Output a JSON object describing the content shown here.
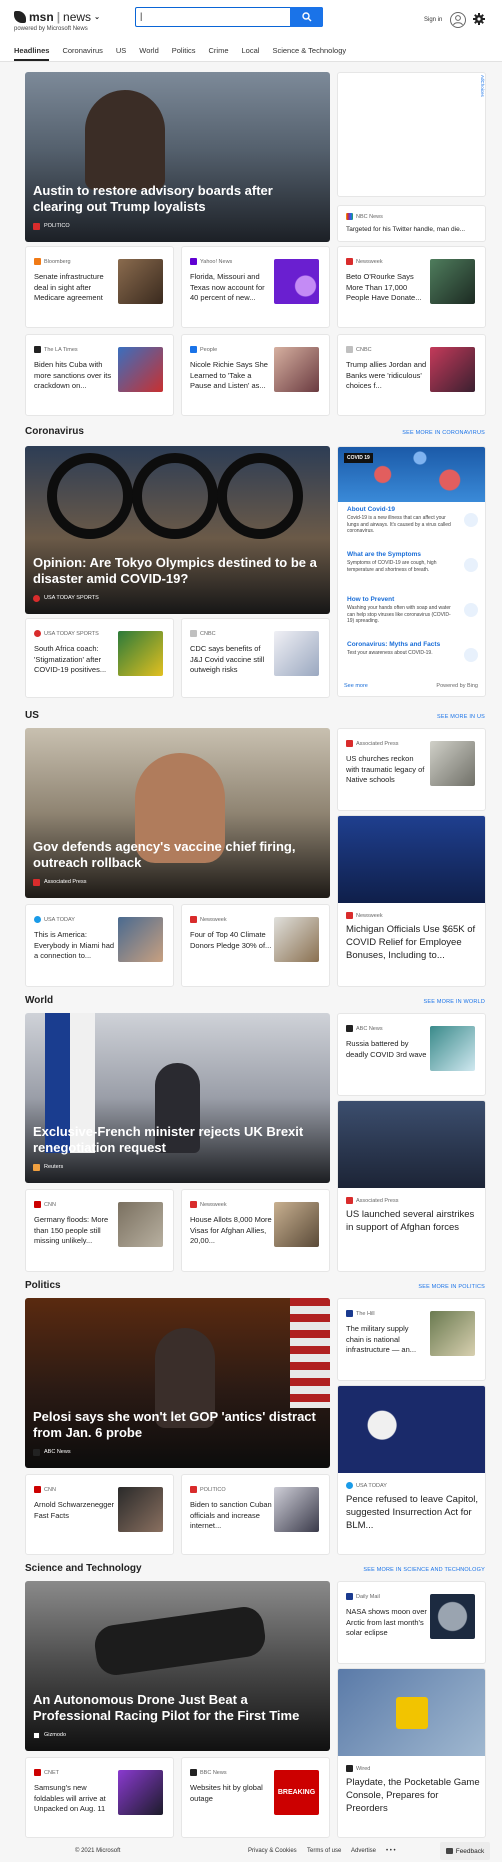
{
  "header": {
    "brand_msn": "msn",
    "brand_news": "news",
    "powered": "powered by Microsoft News",
    "search_value": "|",
    "signin": "Sign in"
  },
  "nav": [
    "Headlines",
    "Coronavirus",
    "US",
    "World",
    "Politics",
    "Crime",
    "Local",
    "Science & Technology"
  ],
  "ad_label": "AdChoices",
  "headlines": {
    "hero": {
      "title": "Austin to restore advisory boards after clearing out Trump loyalists",
      "source": "POLITICO"
    },
    "side": {
      "source": "NBC News",
      "title": "Targeted for his Twitter handle, man die..."
    },
    "cards": [
      {
        "source": "Bloomberg",
        "title": "Senate infrastructure deal in sight after Medicare agreement",
        "icon_color": "#f07a16"
      },
      {
        "source": "Yahoo! News",
        "title": "Florida, Missouri and Texas now account for 40 percent of new...",
        "icon_color": "#6001d2"
      },
      {
        "source": "Newsweek",
        "title": "Beto O'Rourke Says More Than 17,000 People Have Donate...",
        "icon_color": "#d92c2c"
      },
      {
        "source": "The LA Times",
        "title": "Biden hits Cuba with more sanctions over its crackdown on...",
        "icon_color": "#222222"
      },
      {
        "source": "People",
        "title": "Nicole Richie Says She Learned to 'Take a Pause and Listen' as...",
        "icon_color": "#1a73e8"
      },
      {
        "source": "CNBC",
        "title": "Trump allies Jordan and Banks were 'ridiculous' choices f...",
        "icon_color": "#c0c0c0"
      }
    ]
  },
  "coronavirus": {
    "heading": "Coronavirus",
    "more": "SEE MORE IN CORONAVIRUS",
    "hero": {
      "title": "Opinion: Are Tokyo Olympics destined to be a disaster amid COVID-19?",
      "source": "USA TODAY SPORTS"
    },
    "cards": [
      {
        "source": "USA TODAY SPORTS",
        "title": "South Africa coach: 'Stigmatization' after COVID-19 positives...",
        "icon_color": "#d92c2c"
      },
      {
        "source": "CNBC",
        "title": "CDC says benefits of J&J Covid vaccine still outweigh risks",
        "icon_color": "#c0c0c0"
      }
    ],
    "panel": {
      "tag": "COVID 19",
      "items": [
        {
          "title": "About Covid-19",
          "desc": "Covid-19 is a new illness that can affect your lungs and airways. It's caused by a virus called coronavirus."
        },
        {
          "title": "What are the Symptoms",
          "desc": "Symptoms of COVID-19 are cough, high temperature and shortness of breath."
        },
        {
          "title": "How to Prevent",
          "desc": "Washing your hands often with soap and water can help stop viruses like coronavirus (COVID-19) spreading."
        },
        {
          "title": "Coronavirus: Myths and Facts",
          "desc": "Test your awareness about COVID-19."
        }
      ],
      "see_more": "See more",
      "powered": "Powered by Bing"
    }
  },
  "us": {
    "heading": "US",
    "more": "SEE MORE IN US",
    "hero": {
      "title": "Gov defends agency's vaccine chief firing, outreach rollback",
      "source": "Associated Press"
    },
    "side": {
      "source": "Associated Press",
      "title": "US churches reckon with traumatic legacy of Native schools"
    },
    "tall": {
      "source": "Newsweek",
      "title": "Michigan Officials Use $65K of COVID Relief for Employee Bonuses, Including to..."
    },
    "cards": [
      {
        "source": "USA TODAY",
        "title": "This is America: Everybody in Miami had a connection to...",
        "icon_color": "#1a9be8"
      },
      {
        "source": "Newsweek",
        "title": "Four of Top 40 Climate Donors Pledge 30% of...",
        "icon_color": "#d92c2c"
      }
    ]
  },
  "world": {
    "heading": "World",
    "more": "SEE MORE IN WORLD",
    "hero": {
      "title": "Exclusive-French minister rejects UK Brexit renegotiation request",
      "source": "Reuters"
    },
    "side": {
      "source": "ABC News",
      "title": "Russia battered by deadly COVID 3rd wave"
    },
    "tall": {
      "source": "Associated Press",
      "title": "US launched several airstrikes in support of Afghan forces"
    },
    "cards": [
      {
        "source": "CNN",
        "title": "Germany floods: More than 150 people still missing unlikely...",
        "icon_color": "#cc0000"
      },
      {
        "source": "Newsweek",
        "title": "House Allots 8,000 More Visas for Afghan Allies, 20,00...",
        "icon_color": "#d92c2c"
      }
    ]
  },
  "politics": {
    "heading": "Politics",
    "more": "SEE MORE IN POLITICS",
    "hero": {
      "title": "Pelosi says she won't let GOP 'antics' distract from Jan. 6 probe",
      "source": "ABC News"
    },
    "side": {
      "source": "The Hill",
      "title": "The military supply chain is national infrastructure — an..."
    },
    "tall": {
      "source": "USA TODAY",
      "title": "Pence refused to leave Capitol, suggested Insurrection Act for BLM..."
    },
    "cards": [
      {
        "source": "CNN",
        "title": "Arnold Schwarzenegger Fast Facts",
        "icon_color": "#cc0000"
      },
      {
        "source": "POLITICO",
        "title": "Biden to sanction Cuban officials and increase internet...",
        "icon_color": "#d92c2c"
      }
    ]
  },
  "scitech": {
    "heading": "Science and Technology",
    "more": "SEE MORE IN SCIENCE AND TECHNOLOGY",
    "hero": {
      "title": "An Autonomous Drone Just Beat a Professional Racing Pilot for the First Time",
      "source": "Gizmodo"
    },
    "side": {
      "source": "Daily Mail",
      "title": "NASA shows moon over Arctic from last month's solar eclipse"
    },
    "tall": {
      "source": "Wired",
      "title": "Playdate, the Pocketable Game Console, Prepares for Preorders"
    },
    "cards": [
      {
        "source": "CNET",
        "title": "Samsung's new foldables will arrive at Unpacked on Aug. 11",
        "icon_color": "#cc0000"
      },
      {
        "source": "BBC News",
        "title": "Websites hit by global outage",
        "icon_color": "#222222"
      }
    ],
    "breaking": "BREAKING"
  },
  "footer": {
    "copyright": "© 2021 Microsoft",
    "privacy": "Privacy & Cookies",
    "terms": "Terms of use",
    "advertise": "Advertise",
    "more": "• • •",
    "feedback": "Feedback"
  }
}
